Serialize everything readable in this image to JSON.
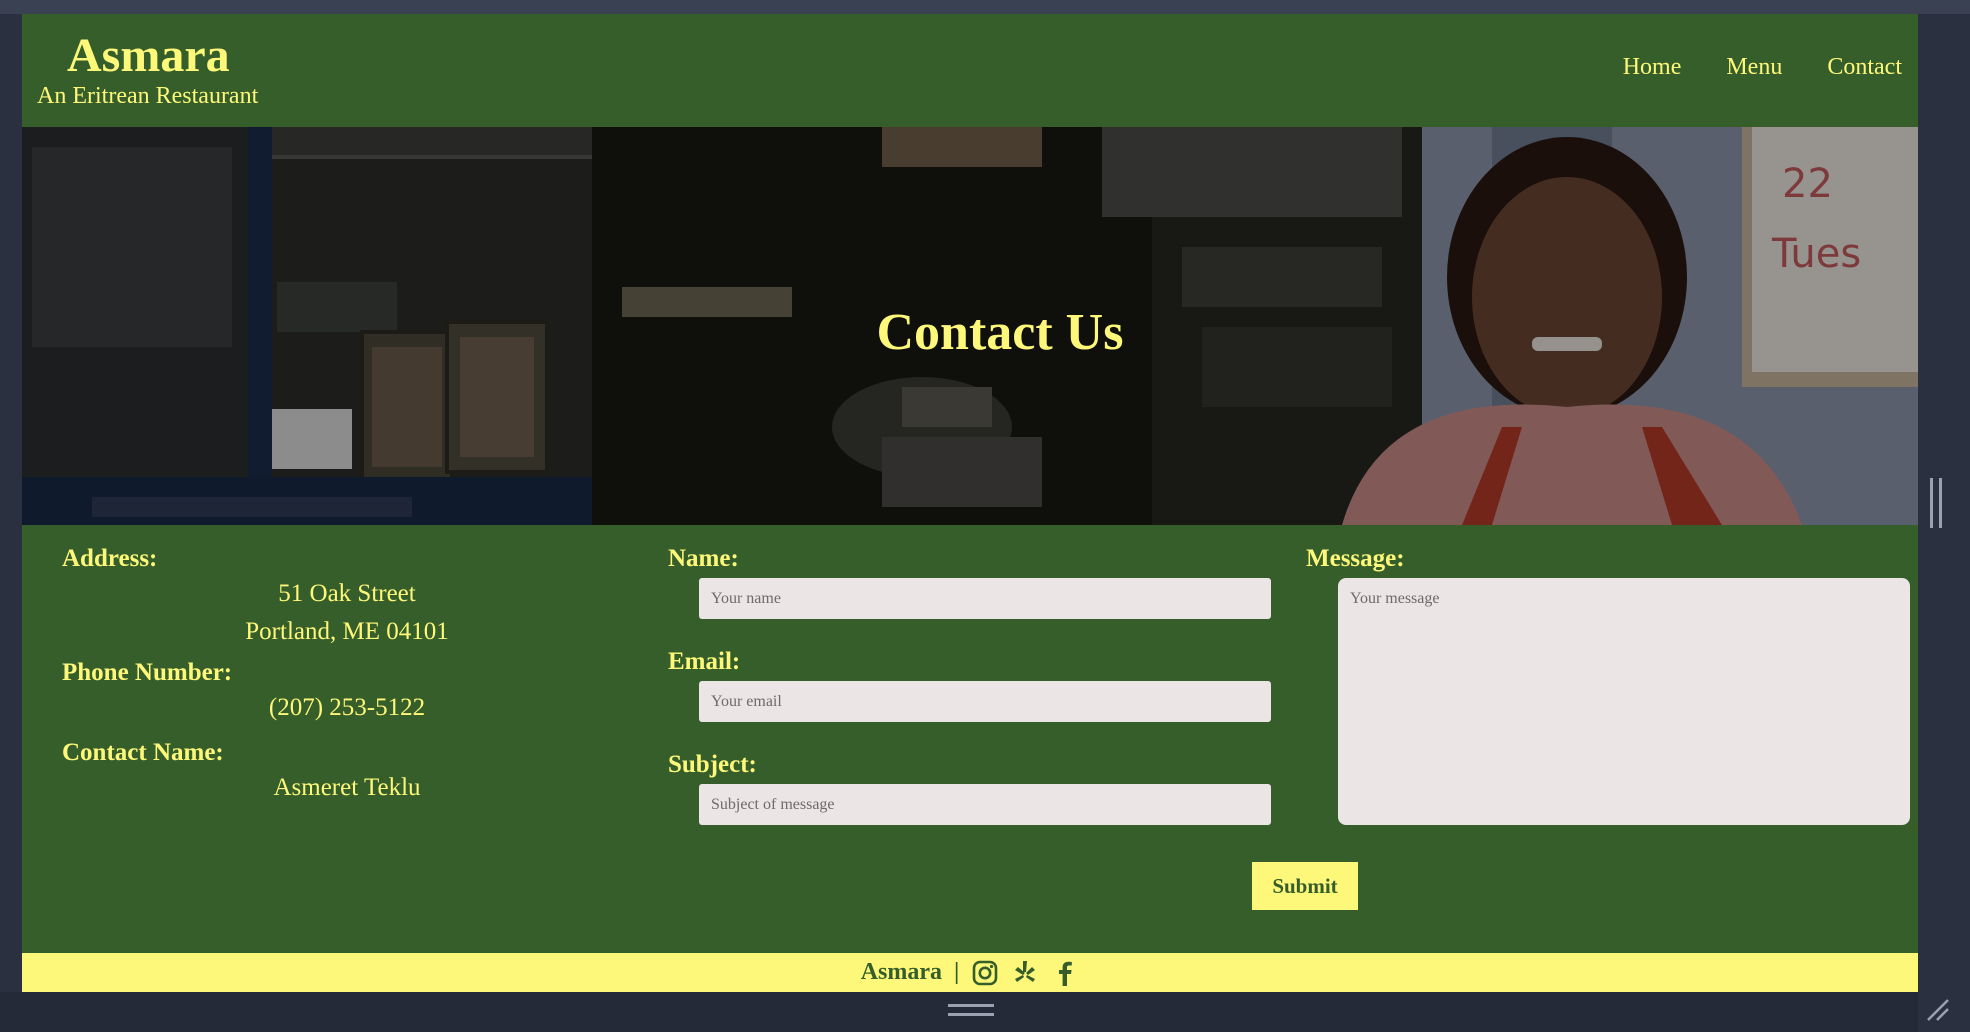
{
  "brand": {
    "title": "Asmara",
    "subtitle": "An Eritrean Restaurant"
  },
  "nav": {
    "items": [
      "Home",
      "Menu",
      "Contact"
    ]
  },
  "hero": {
    "title": "Contact Us"
  },
  "contact_info": {
    "address_label": "Address:",
    "address_line1": "51 Oak Street",
    "address_line2": "Portland, ME 04101",
    "phone_label": "Phone Number:",
    "phone": "(207) 253-5122",
    "name_label": "Contact Name:",
    "name": "Asmeret Teklu"
  },
  "form": {
    "name_label": "Name:",
    "name_placeholder": "Your name",
    "email_label": "Email:",
    "email_placeholder": "Your email",
    "subject_label": "Subject:",
    "subject_placeholder": "Subject of message",
    "message_label": "Message:",
    "message_placeholder": "Your message",
    "submit_label": "Submit"
  },
  "footer": {
    "brand": "Asmara",
    "separator": "|",
    "social_icons": [
      "instagram-icon",
      "yelp-icon",
      "facebook-icon"
    ]
  },
  "colors": {
    "primary_green": "#365e2b",
    "accent_yellow": "#fdf87a",
    "input_bg": "#ebe5e5"
  }
}
